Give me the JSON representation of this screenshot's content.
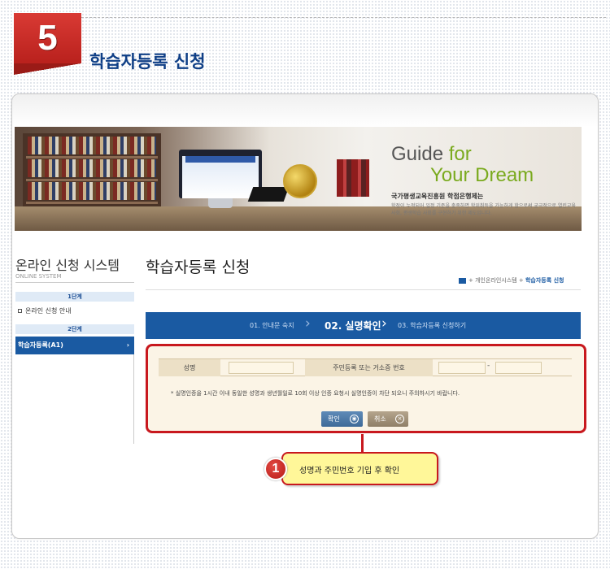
{
  "step": {
    "number": "5",
    "title": "학습자등록 신청"
  },
  "banner": {
    "heading_line1_a": "Guide ",
    "heading_line1_b": "for",
    "heading_line2": "Your Dream",
    "subtitle": "국가평생교육진흥원 학점은행제는",
    "body": "학점이 누적되어 일정 기준을 충족하면 학위취득을 가능하게 함으로써 궁극적으로 열린교육사회, 평생학습 사회를 구현하기 위한 제도입니다."
  },
  "sidebar": {
    "title": "온라인 신청 시스템",
    "subtitle": "ONLINE SYSTEM",
    "stage1": "1단계",
    "item1": "온라인 신청 안내",
    "stage2": "2단계",
    "active_item": "학습자등록(A1)",
    "active_chevron": "›"
  },
  "content": {
    "title": "학습자등록 신청",
    "breadcrumb_middle": "+ 개인온라인시스템 + ",
    "breadcrumb_current": "학습자등록 신청"
  },
  "steps": {
    "step1": "01. 안내문 숙지",
    "step2": "02. 실명확인",
    "step3": "03. 학습자등록 신청하기",
    "arrow": "›"
  },
  "form": {
    "name_label": "성명",
    "id_label": "주민등록 또는 거소증 번호",
    "separator": "-",
    "notice": "* 실명인증을 1시간 이내 동일한 성명과 생년월일로 10회 이상 인증 요청시 실명인증이 차단 되오니 주의하시기 바랍니다.",
    "confirm_label": "확인",
    "cancel_label": "취소",
    "cancel_icon_glyph": "×"
  },
  "callout": {
    "number": "1",
    "text": "성명과 주민번호 기입 후 확인"
  },
  "colors": {
    "accent_red": "#c8181e",
    "nav_blue": "#1a5aa2",
    "title_blue": "#0f3f86",
    "callout_yellow": "#fff799"
  }
}
